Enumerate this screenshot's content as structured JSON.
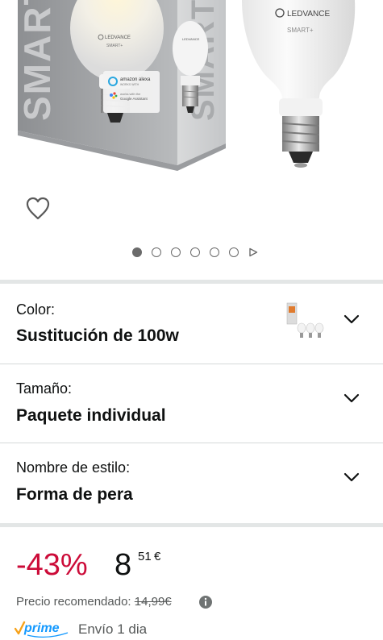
{
  "product_image": {
    "box_text": "SMART",
    "bulb_brand": "LEDVANCE",
    "bulb_sub": "SMART+",
    "box_badge_1": "amazon alexa",
    "box_badge_2": "Google Assistant"
  },
  "gallery": {
    "total_images": 6,
    "active_index": 0
  },
  "options": {
    "color": {
      "label": "Color:",
      "value": "Sustitución de 100w"
    },
    "size": {
      "label": "Tamaño:",
      "value": "Paquete individual"
    },
    "style": {
      "label": "Nombre de estilo:",
      "value": "Forma de pera"
    }
  },
  "price": {
    "discount": "-43%",
    "whole": "8",
    "fraction": "51",
    "currency": "€",
    "recommended_label": "Precio recomendado:",
    "recommended_value": "14,99€"
  },
  "delivery": {
    "prime_label": "prime",
    "text": "Envío 1 dia"
  },
  "colors": {
    "discount_red": "#cc0c39",
    "prime_blue": "#1399ff",
    "prime_check": "#f7a21b",
    "divider_gray": "#e3e6e6"
  }
}
